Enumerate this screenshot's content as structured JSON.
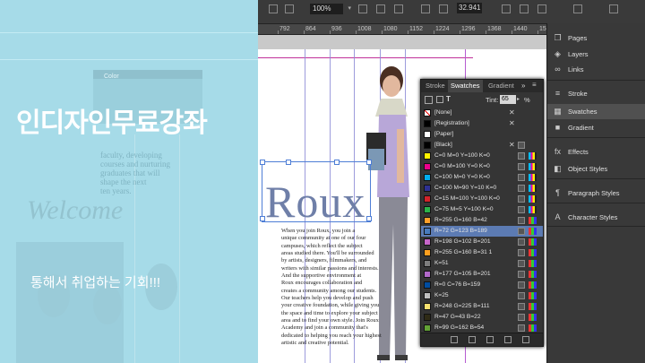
{
  "overlay": {
    "title": "인디자인무료강좌",
    "subtitle": "통해서 취업하는 기회!!!",
    "ghost_text": {
      "color_label": "Color",
      "welcome": "Welcome",
      "brochure_lines": [
        "faculty, developing",
        "courses and nurturing",
        "graduates that will",
        "shape the next",
        "ten years."
      ]
    }
  },
  "toolbar": {
    "zoom": "100%",
    "coord": "32.941"
  },
  "ruler": {
    "labels": [
      "792",
      "864",
      "936",
      "1008",
      "1080",
      "1152",
      "1224",
      "1296",
      "1368",
      "1440",
      "1512"
    ]
  },
  "document": {
    "heading": "Roux",
    "body_lines": [
      "When you join Roux, you join a",
      "unique community at one of our four",
      "campuses, which reflect the subject",
      "areas studied there. You'll be surrounded",
      "by artists, designers, filmmakers, and",
      "writers with similar passions and interests.",
      "And the supportive environment at",
      "Roux encourages collaboration and",
      "creates a community among our students.",
      "Our teachers help you develop and push",
      "your creative foundation, while giving you",
      "the space and time to explore your subject",
      "area and to find your own style. Join Roux",
      "Academy and join a community that's",
      "dedicated to helping you reach your highest",
      "artistic and creative potential."
    ]
  },
  "swatches_panel": {
    "tabs": [
      "Stroke",
      "Swatches",
      "Gradient"
    ],
    "tint_label": "Tint:",
    "tint_value": "65",
    "tint_unit": "%",
    "items": [
      {
        "name": "[None]",
        "color": "none"
      },
      {
        "name": "[Registration]",
        "color": "#000000"
      },
      {
        "name": "[Paper]",
        "color": "#ffffff"
      },
      {
        "name": "[Black]",
        "color": "#000000"
      },
      {
        "name": "C=0 M=0 Y=100 K=0",
        "color": "#fff200"
      },
      {
        "name": "C=0 M=100 Y=0 K=0",
        "color": "#ec008c"
      },
      {
        "name": "C=100 M=0 Y=0 K=0",
        "color": "#00aeef"
      },
      {
        "name": "C=100 M=90 Y=10 K=0",
        "color": "#2e3192"
      },
      {
        "name": "C=15 M=100 Y=100 K=0",
        "color": "#d2232a"
      },
      {
        "name": "C=75 M=5 Y=100 K=0",
        "color": "#2bb24a"
      },
      {
        "name": "R=255 G=160 B=42",
        "color": "#ffa02a"
      },
      {
        "name": "R=72 G=123 B=189",
        "color": "#487bbd",
        "selected": true
      },
      {
        "name": "R=198 G=102 B=201",
        "color": "#c666c9"
      },
      {
        "name": "R=255 G=160 B=31 1",
        "color": "#ffa01f"
      },
      {
        "name": "K=51",
        "color": "#7d7d7d"
      },
      {
        "name": "R=177 G=105 B=201",
        "color": "#b169c9"
      },
      {
        "name": "R=0 C=76 B=159",
        "color": "#004c9f"
      },
      {
        "name": "K=25",
        "color": "#bfbfbf"
      },
      {
        "name": "R=248 G=225 B=111",
        "color": "#f8e16f"
      },
      {
        "name": "R=47 G=43 B=22",
        "color": "#2f2b16"
      },
      {
        "name": "R=99 G=162 B=54",
        "color": "#63a236"
      }
    ]
  },
  "dock": {
    "items": [
      {
        "label": "Pages",
        "icon": "pages-icon",
        "glyph": "❐"
      },
      {
        "label": "Layers",
        "icon": "layers-icon",
        "glyph": "◈"
      },
      {
        "label": "Links",
        "icon": "links-icon",
        "glyph": "∞"
      },
      {
        "label": "Stroke",
        "icon": "stroke-icon",
        "glyph": "≡"
      },
      {
        "label": "Swatches",
        "icon": "swatches-icon",
        "glyph": "▦"
      },
      {
        "label": "Gradient",
        "icon": "gradient-icon",
        "glyph": "■"
      },
      {
        "label": "Effects",
        "icon": "effects-icon",
        "glyph": "fx"
      },
      {
        "label": "Object Styles",
        "icon": "object-styles-icon",
        "glyph": "◧"
      },
      {
        "label": "Paragraph Styles",
        "icon": "paragraph-styles-icon",
        "glyph": "¶"
      },
      {
        "label": "Character Styles",
        "icon": "character-styles-icon",
        "glyph": "A"
      }
    ]
  }
}
